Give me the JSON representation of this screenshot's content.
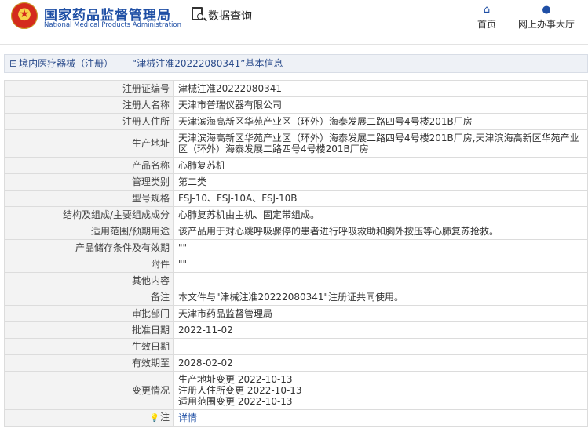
{
  "header": {
    "brand_cn": "国家药品监督管理局",
    "brand_en": "National Medical Products Administration",
    "query_title": "数据查询",
    "nav_home": "首页",
    "nav_hall": "网上办事大厅",
    "brand_color": "#1f4fa5"
  },
  "breadcrumb": "境内医疗器械（注册）——“津械注准20222080341”基本信息",
  "rows": [
    {
      "label": "注册证编号",
      "value": "津械注准20222080341"
    },
    {
      "label": "注册人名称",
      "value": "天津市普瑞仪器有限公司"
    },
    {
      "label": "注册人住所",
      "value": "天津滨海高新区华苑产业区（环外）海泰发展二路四号4号楼201B厂房"
    },
    {
      "label": "生产地址",
      "value": "天津滨海高新区华苑产业区（环外）海泰发展二路四号4号楼201B厂房,天津滨海高新区华苑产业区（环外）海泰发展二路四号4号楼201B厂房"
    },
    {
      "label": "产品名称",
      "value": "心肺复苏机"
    },
    {
      "label": "管理类别",
      "value": "第二类"
    },
    {
      "label": "型号规格",
      "value": "FSJ-10、FSJ-10A、FSJ-10B"
    },
    {
      "label": "结构及组成/主要组成成分",
      "value": "心肺复苏机由主机、固定带组成。"
    },
    {
      "label": "适用范围/预期用途",
      "value": "该产品用于对心跳呼吸骤停的患者进行呼吸救助和胸外按压等心肺复苏抢救。"
    },
    {
      "label": "产品储存条件及有效期",
      "value": "\"\""
    },
    {
      "label": "附件",
      "value": "\"\""
    },
    {
      "label": "其他内容",
      "value": ""
    },
    {
      "label": "备注",
      "value": "本文件与\"津械注准20222080341\"注册证共同使用。"
    },
    {
      "label": "审批部门",
      "value": "天津市药品监督管理局"
    },
    {
      "label": "批准日期",
      "value": "2022-11-02"
    },
    {
      "label": "生效日期",
      "value": ""
    },
    {
      "label": "有效期至",
      "value": "2028-02-02"
    },
    {
      "label": "变更情况",
      "value_lines": [
        "生产地址变更 2022-10-13",
        "注册人住所变更 2022-10-13",
        "适用范围变更 2022-10-13"
      ]
    },
    {
      "label": "注",
      "value": "详情",
      "icon": "bulb-icon"
    }
  ]
}
